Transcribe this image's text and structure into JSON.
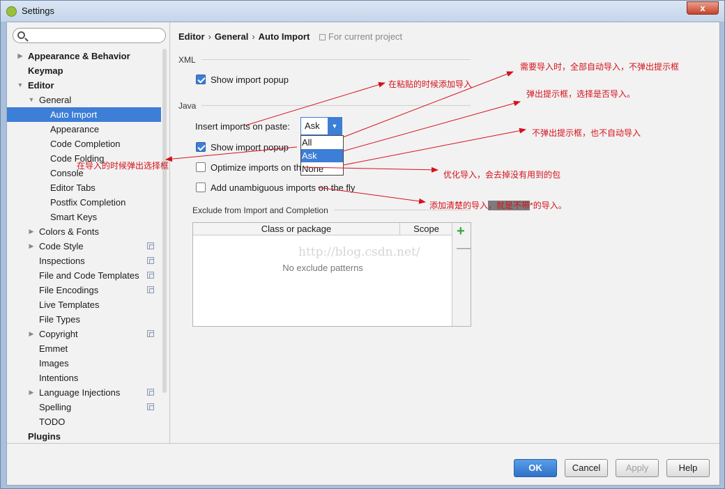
{
  "window": {
    "title": "Settings",
    "close_label": "x"
  },
  "sidebar": {
    "search_placeholder": "",
    "items": [
      {
        "label": "Appearance & Behavior",
        "bold": true,
        "arrow": "right",
        "depth": 0
      },
      {
        "label": "Keymap",
        "bold": true,
        "arrow": "",
        "depth": 0
      },
      {
        "label": "Editor",
        "bold": true,
        "arrow": "down",
        "depth": 0
      },
      {
        "label": "General",
        "bold": false,
        "arrow": "down",
        "depth": 1
      },
      {
        "label": "Auto Import",
        "bold": false,
        "arrow": "",
        "depth": 2,
        "selected": true
      },
      {
        "label": "Appearance",
        "bold": false,
        "arrow": "",
        "depth": 2
      },
      {
        "label": "Code Completion",
        "bold": false,
        "arrow": "",
        "depth": 2
      },
      {
        "label": "Code Folding",
        "bold": false,
        "arrow": "",
        "depth": 2
      },
      {
        "label": "Console",
        "bold": false,
        "arrow": "",
        "depth": 2
      },
      {
        "label": "Editor Tabs",
        "bold": false,
        "arrow": "",
        "depth": 2
      },
      {
        "label": "Postfix Completion",
        "bold": false,
        "arrow": "",
        "depth": 2
      },
      {
        "label": "Smart Keys",
        "bold": false,
        "arrow": "",
        "depth": 2
      },
      {
        "label": "Colors & Fonts",
        "bold": false,
        "arrow": "right",
        "depth": 1
      },
      {
        "label": "Code Style",
        "bold": false,
        "arrow": "right",
        "depth": 1,
        "project": true
      },
      {
        "label": "Inspections",
        "bold": false,
        "arrow": "",
        "depth": 1,
        "project": true
      },
      {
        "label": "File and Code Templates",
        "bold": false,
        "arrow": "",
        "depth": 1,
        "project": true
      },
      {
        "label": "File Encodings",
        "bold": false,
        "arrow": "",
        "depth": 1,
        "project": true
      },
      {
        "label": "Live Templates",
        "bold": false,
        "arrow": "",
        "depth": 1
      },
      {
        "label": "File Types",
        "bold": false,
        "arrow": "",
        "depth": 1
      },
      {
        "label": "Copyright",
        "bold": false,
        "arrow": "right",
        "depth": 1,
        "project": true
      },
      {
        "label": "Emmet",
        "bold": false,
        "arrow": "",
        "depth": 1
      },
      {
        "label": "Images",
        "bold": false,
        "arrow": "",
        "depth": 1
      },
      {
        "label": "Intentions",
        "bold": false,
        "arrow": "",
        "depth": 1
      },
      {
        "label": "Language Injections",
        "bold": false,
        "arrow": "right",
        "depth": 1,
        "project": true
      },
      {
        "label": "Spelling",
        "bold": false,
        "arrow": "",
        "depth": 1,
        "project": true
      },
      {
        "label": "TODO",
        "bold": false,
        "arrow": "",
        "depth": 1
      },
      {
        "label": "Plugins",
        "bold": true,
        "arrow": "",
        "depth": 0
      }
    ]
  },
  "main": {
    "breadcrumb": {
      "part1": "Editor",
      "part2": "General",
      "part3": "Auto Import",
      "scope": "For current project"
    },
    "xml": {
      "label": "XML",
      "show_popup": "Show import popup"
    },
    "java": {
      "label": "Java",
      "insert_label": "Insert imports on paste:",
      "insert_value": "Ask",
      "options": [
        "All",
        "Ask",
        "None"
      ],
      "show_popup": "Show import popup",
      "optimize": "Optimize imports on the fly",
      "unambiguous": "Add unambiguous imports on the fly"
    },
    "exclude": {
      "label": "Exclude from Import and Completion",
      "col_class": "Class or package",
      "col_scope": "Scope",
      "empty": "No exclude patterns",
      "add": "+",
      "remove": "—"
    },
    "watermark": "http://blog.csdn.net/"
  },
  "footer": {
    "ok": "OK",
    "cancel": "Cancel",
    "apply": "Apply",
    "help": "Help"
  },
  "annotations": {
    "paste": "在粘贴的时候添加导入",
    "all": "需要导入时，全部自动导入，不弹出提示框",
    "ask": "弹出提示框，选择是否导入。",
    "none": "不弹出提示框，也不自动导入",
    "popup": "在导入的时候弹出选择框",
    "optimize": "优化导入，会去掉没有用到的包",
    "unamb_a": "添加清楚的导入",
    "unamb_b": "，就是不带",
    "unamb_c": "*的导入。"
  },
  "colors": {
    "accent": "#3d7ed6",
    "annotation": "#d4121b"
  }
}
